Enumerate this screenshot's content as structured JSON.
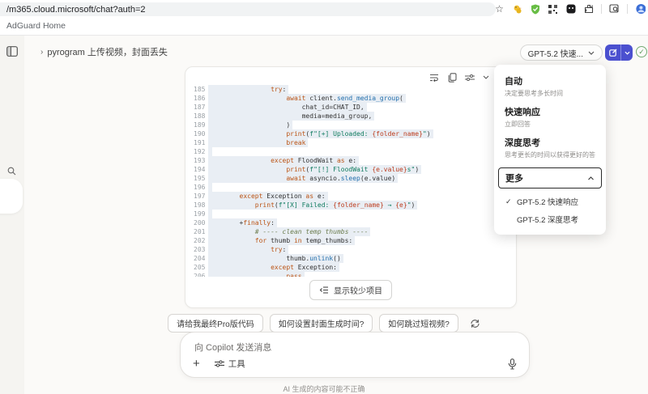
{
  "browser": {
    "url": "/m365.cloud.microsoft/chat?auth=2",
    "bookmark_label": "AdGuard Home",
    "icon_names": [
      "bookmark-star-icon",
      "duck-extension-icon",
      "adguard-shield-icon",
      "qr-extension-icon",
      "dark-extension-icon",
      "extensions-puzzle-icon",
      "screenshot-search-icon",
      "profile-avatar"
    ]
  },
  "header": {
    "chat_title": "pyrogram 上传视频，封面丢失",
    "model_pill_label": "GPT-5.2 快速...",
    "adguard_badge": "✓"
  },
  "model_menu": {
    "items": [
      {
        "label": "自动",
        "desc": "决定要思考多长时间"
      },
      {
        "label": "快速响应",
        "desc": "立即回答"
      },
      {
        "label": "深度思考",
        "desc": "思考更长的时间以获得更好的答案"
      }
    ],
    "more_label": "更多",
    "more_options": [
      {
        "label": "GPT-5.2 快速响应",
        "checked": true
      },
      {
        "label": "GPT-5.2 深度思考",
        "checked": false
      }
    ]
  },
  "code_block": {
    "toolbar_code_toggle": "</>",
    "lines": [
      {
        "n": "185",
        "s": [
          [
            "                ",
            "pl"
          ],
          [
            "try",
            "kw"
          ],
          [
            ":",
            "pl"
          ]
        ]
      },
      {
        "n": "186",
        "s": [
          [
            "                    ",
            "pl"
          ],
          [
            "await",
            "kw"
          ],
          [
            " client.",
            "pl"
          ],
          [
            "send_media_group",
            "fn"
          ],
          [
            "(",
            "pl"
          ]
        ]
      },
      {
        "n": "187",
        "s": [
          [
            "                        chat_id=CHAT_ID,",
            "pl"
          ]
        ]
      },
      {
        "n": "188",
        "s": [
          [
            "                        media=media_group,",
            "pl"
          ]
        ]
      },
      {
        "n": "189",
        "s": [
          [
            "                    )",
            "pl"
          ]
        ]
      },
      {
        "n": "190",
        "s": [
          [
            "                    ",
            "pl"
          ],
          [
            "print",
            "bi"
          ],
          [
            "(",
            "pl"
          ],
          [
            "f\"[+] Uploaded: ",
            "str"
          ],
          [
            "{folder_name}",
            "itp"
          ],
          [
            "\"",
            "str"
          ],
          [
            ")",
            "pl"
          ]
        ]
      },
      {
        "n": "191",
        "s": [
          [
            "                    ",
            "pl"
          ],
          [
            "break",
            "kw"
          ]
        ]
      },
      {
        "n": "192",
        "s": []
      },
      {
        "n": "193",
        "s": [
          [
            "                ",
            "pl"
          ],
          [
            "except",
            "kw"
          ],
          [
            " FloodWait ",
            "pl"
          ],
          [
            "as",
            "kw"
          ],
          [
            " e:",
            "pl"
          ]
        ]
      },
      {
        "n": "194",
        "s": [
          [
            "                    ",
            "pl"
          ],
          [
            "print",
            "bi"
          ],
          [
            "(",
            "pl"
          ],
          [
            "f\"[!] FloodWait ",
            "str"
          ],
          [
            "{e.value}",
            "itp"
          ],
          [
            "s\"",
            "str"
          ],
          [
            ")",
            "pl"
          ]
        ]
      },
      {
        "n": "195",
        "s": [
          [
            "                    ",
            "pl"
          ],
          [
            "await",
            "kw"
          ],
          [
            " asyncio.",
            "pl"
          ],
          [
            "sleep",
            "fn"
          ],
          [
            "(e.value)",
            "pl"
          ]
        ]
      },
      {
        "n": "196",
        "s": []
      },
      {
        "n": "197",
        "s": [
          [
            "        ",
            "pl"
          ],
          [
            "except",
            "kw"
          ],
          [
            " Exception ",
            "pl"
          ],
          [
            "as",
            "kw"
          ],
          [
            " e:",
            "pl"
          ]
        ]
      },
      {
        "n": "198",
        "s": [
          [
            "            ",
            "pl"
          ],
          [
            "print",
            "bi"
          ],
          [
            "(",
            "pl"
          ],
          [
            "f\"[X] Failed: ",
            "str"
          ],
          [
            "{folder_name}",
            "itp"
          ],
          [
            " → ",
            "str"
          ],
          [
            "{e}",
            "itp"
          ],
          [
            "\"",
            "str"
          ],
          [
            ")",
            "pl"
          ]
        ]
      },
      {
        "n": "199",
        "s": []
      },
      {
        "n": "200",
        "s": [
          [
            "        +",
            "pl"
          ],
          [
            "finally",
            "kw"
          ],
          [
            ":",
            "pl"
          ]
        ]
      },
      {
        "n": "201",
        "s": [
          [
            "            ",
            "pl"
          ],
          [
            "# ---- clean temp thumbs ----",
            "cm"
          ]
        ]
      },
      {
        "n": "202",
        "s": [
          [
            "            ",
            "pl"
          ],
          [
            "for",
            "kw"
          ],
          [
            " thumb ",
            "pl"
          ],
          [
            "in",
            "kw"
          ],
          [
            " temp_thumbs:",
            "pl"
          ]
        ]
      },
      {
        "n": "203",
        "s": [
          [
            "                ",
            "pl"
          ],
          [
            "try",
            "kw"
          ],
          [
            ":",
            "pl"
          ]
        ]
      },
      {
        "n": "204",
        "s": [
          [
            "                    thumb.",
            "pl"
          ],
          [
            "unlink",
            "fn"
          ],
          [
            "()",
            "pl"
          ]
        ]
      },
      {
        "n": "205",
        "s": [
          [
            "                ",
            "pl"
          ],
          [
            "except",
            "kw"
          ],
          [
            " Exception:",
            "pl"
          ]
        ]
      },
      {
        "n": "206",
        "s": [
          [
            "                    ",
            "pl"
          ],
          [
            "pass",
            "kw"
          ]
        ]
      }
    ],
    "show_less_label": "显示较少项目"
  },
  "suggestions": [
    "请给我最终Pro版代码",
    "如何设置封面生成时间?",
    "如何跳过短视频?"
  ],
  "composer": {
    "placeholder": "向 Copilot 发送消息",
    "tools_label": "工具"
  },
  "footer_disclaimer": "AI 生成的内容可能不正确",
  "colors": {
    "accent_blue": "#4b50cf",
    "selection_highlight": "#e9eef4",
    "adguard_green": "#74ab74"
  }
}
